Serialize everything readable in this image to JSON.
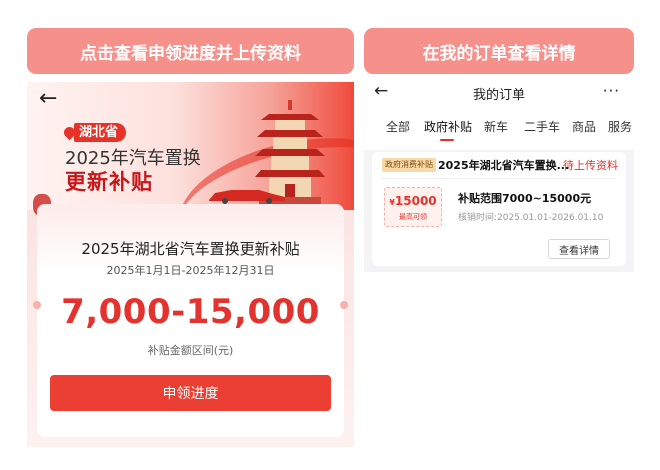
{
  "banners": {
    "left": "点击查看申领进度并上传资料",
    "right": "在我的订单查看详情"
  },
  "subsidy_page": {
    "location": "湖北省",
    "hero_line1": "2025年汽车置换",
    "hero_line2": "更新补贴",
    "card": {
      "title": "2025年湖北省汽车置换更新补贴",
      "date_range": "2025年1月1日-2025年12月31日",
      "amount_range": "7,000-15,000",
      "amount_caption": "补贴金额区间(元)",
      "button_label": "申领进度"
    },
    "icons": [
      "back-arrow-icon",
      "location-pin-icon",
      "tower-illustration",
      "car-illustration"
    ],
    "colors": {
      "accent": "#e3332e",
      "button": "#ec3f33",
      "banner": "#f6908b"
    }
  },
  "orders_page": {
    "title": "我的订单",
    "back_glyph": "←",
    "more_glyph": "···",
    "tabs": [
      "全部",
      "政府补贴",
      "新车",
      "二手车",
      "商品",
      "服务"
    ],
    "active_tab": "政府补贴",
    "order": {
      "badge": "政府消费补贴",
      "title": "2025年湖北省汽车置换...",
      "status": "待上传资料",
      "coupon_currency": "¥",
      "coupon_value": "15000",
      "coupon_caption": "最高可领",
      "range": "补贴范围7000~15000元",
      "period": "核销时间:2025.01.01-2026.01.10",
      "detail_button": "查看详情"
    }
  }
}
